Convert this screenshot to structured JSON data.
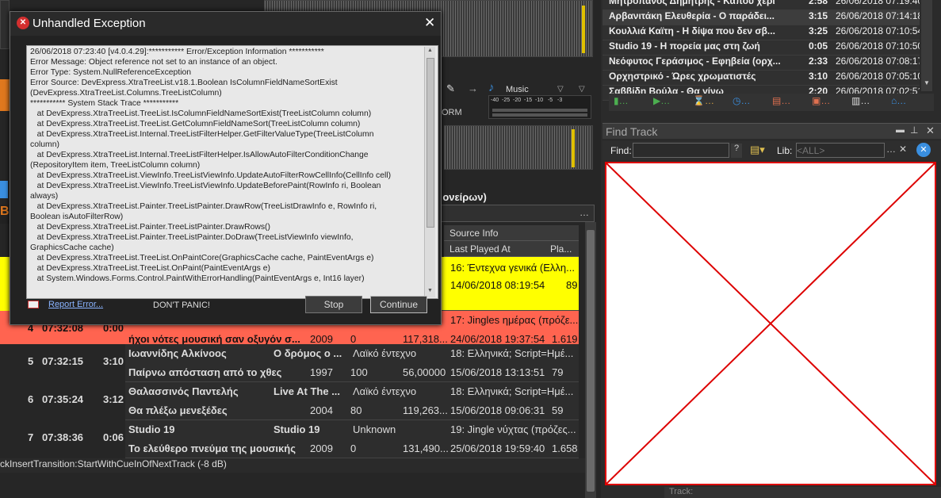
{
  "dialog": {
    "title": "Unhandled Exception",
    "error_lines": [
      "26/06/2018 07:23:40 [v4.0.4.29]:*********** Error/Exception Information ***********",
      "Error Message: Object reference not set to an instance of an object.",
      "Error Type: System.NullReferenceException",
      "Error Source: DevExpress.XtraTreeList.v18.1.Boolean IsColumnFieldNameSortExist",
      "(DevExpress.XtraTreeList.Columns.TreeListColumn)",
      "*********** System Stack Trace ***********",
      "   at DevExpress.XtraTreeList.TreeList.IsColumnFieldNameSortExist(TreeListColumn column)",
      "   at DevExpress.XtraTreeList.TreeList.GetColumnFieldNameSort(TreeListColumn column)",
      "   at DevExpress.XtraTreeList.Internal.TreeListFilterHelper.GetFilterValueType(TreeListColumn",
      "column)",
      "   at DevExpress.XtraTreeList.Internal.TreeListFilterHelper.IsAllowAutoFilterConditionChange",
      "(RepositoryItem item, TreeListColumn column)",
      "   at DevExpress.XtraTreeList.ViewInfo.TreeListViewInfo.UpdateAutoFilterRowCellInfo(CellInfo cell)",
      "   at DevExpress.XtraTreeList.ViewInfo.TreeListViewInfo.UpdateBeforePaint(RowInfo ri, Boolean",
      "always)",
      "   at DevExpress.XtraTreeList.Painter.TreeListPainter.DrawRow(TreeListDrawInfo e, RowInfo ri,",
      "Boolean isAutoFilterRow)",
      "   at DevExpress.XtraTreeList.Painter.TreeListPainter.DrawRows()",
      "   at DevExpress.XtraTreeList.Painter.TreeListPainter.DoDraw(TreeListViewInfo viewInfo,",
      "GraphicsCache cache)",
      "   at DevExpress.XtraTreeList.TreeList.OnPaintCore(GraphicsCache cache, PaintEventArgs e)",
      "   at DevExpress.XtraTreeList.TreeList.OnPaint(PaintEventArgs e)",
      "   at System.Windows.Forms.Control.PaintWithErrorHandling(PaintEventArgs e, Int16 layer)"
    ],
    "report_link": "Report Error...",
    "dont_panic": "DON'T PANIC!",
    "stop_label": "Stop",
    "continue_label": "Continue"
  },
  "player": {
    "music_label": "Music",
    "orm_label": "ORM",
    "meter_scale": "-40  -25  -20  -15  -10   -5   -3",
    "now_playing_title": "ός ονείρων)",
    "colors": {
      "accent_orange": "#e0781e",
      "yellow_row": "#ffff00",
      "red_row": "#ff6450"
    }
  },
  "playlist": {
    "headers": {
      "source_info": "Source Info",
      "last_played": "Last Played At",
      "plays": "Pla..."
    },
    "rows": [
      {
        "num": "",
        "time": "",
        "dur": "",
        "artist": "",
        "title_top": "",
        "genre": "",
        "title": "",
        "year": "",
        "bpm": "",
        "size": "",
        "source": "16: Έντεχνα γενικά (Ελλη...",
        "last": "14/06/2018 08:19:54",
        "plays": "89",
        "style": "yellow"
      },
      {
        "num": "4",
        "time": "07:32:08",
        "dur": "0:00",
        "artist": "",
        "title_top": "",
        "genre": "",
        "title": "ήχοι νότες μουσική σαν οξυγόν σ...",
        "year": "2009",
        "bpm": "0",
        "size": "117,318...",
        "source": "17: Jingles ημέρας (πρόζε...",
        "last": "24/06/2018 19:37:54",
        "plays": "1.619",
        "style": "red"
      },
      {
        "num": "5",
        "time": "07:32:15",
        "dur": "3:10",
        "artist": "Ιωαννίδης Αλκίνοος",
        "title_top": "Ο δρόμος ο ...",
        "genre": "Λαϊκό έντεχνο",
        "title": "Παίρνω απόσταση από το χθες",
        "year": "1997",
        "bpm": "100",
        "size": "56,00000",
        "source": "18: Ελληνικά; Script=Ημέ...",
        "last": "15/06/2018 13:13:51",
        "plays": "79",
        "style": "dark"
      },
      {
        "num": "6",
        "time": "07:35:24",
        "dur": "3:12",
        "artist": "Θαλασσινός Παντελής",
        "title_top": "Live At The ...",
        "genre": "Λαϊκό έντεχνο",
        "title": "Θα πλέξω μενεξέδες",
        "year": "2004",
        "bpm": "80",
        "size": "119,263...",
        "source": "18: Ελληνικά; Script=Ημέ...",
        "last": "15/06/2018 09:06:31",
        "plays": "59",
        "style": "dark"
      },
      {
        "num": "7",
        "time": "07:38:36",
        "dur": "0:06",
        "artist": "Studio 19",
        "title_top": "Studio 19",
        "genre": "Unknown",
        "title": "Το ελεύθερο πνεύμα της μουσικής",
        "year": "2009",
        "bpm": "0",
        "size": "131,490...",
        "source": "19: Jingle νύχτας (πρόζες...",
        "last": "25/06/2018 19:59:40",
        "plays": "1.658",
        "style": "dark"
      }
    ],
    "status_line": "ckInsertTransition:StartWithCueInOfNextTrack (-8 dB)"
  },
  "history": [
    {
      "title": "Μητροπάνος Δημήτρης - Κάπου χερι",
      "dur": "2:58",
      "date": "26/06/2018 07:19:40"
    },
    {
      "title": "Αρβανιτάκη Ελευθερία - Ο παράδει...",
      "dur": "3:15",
      "date": "26/06/2018 07:14:18"
    },
    {
      "title": "Κουλλιά Καϊτη - Η δίψα που δεν σβ...",
      "dur": "3:25",
      "date": "26/06/2018 07:10:54"
    },
    {
      "title": "Studio 19 - Η πορεία μας στη ζωή",
      "dur": "0:05",
      "date": "26/06/2018 07:10:50"
    },
    {
      "title": "Νεόφυτος Γεράσιμος - Εφηβεία (ορχ...",
      "dur": "2:33",
      "date": "26/06/2018 07:08:17"
    },
    {
      "title": "Ορχηστρικό - Ώρες χρωματιστές",
      "dur": "3:10",
      "date": "26/06/2018 07:05:10"
    },
    {
      "title": "Σαββίδη Βούλα - Θα γίνω",
      "dur": "2:20",
      "date": "26/06/2018 07:02:51"
    }
  ],
  "find_track": {
    "title": "Find Track",
    "find_label": "Find:",
    "find_value": "",
    "lib_label": "Lib:",
    "lib_placeholder": "<ALL>",
    "footer": "Track:"
  }
}
